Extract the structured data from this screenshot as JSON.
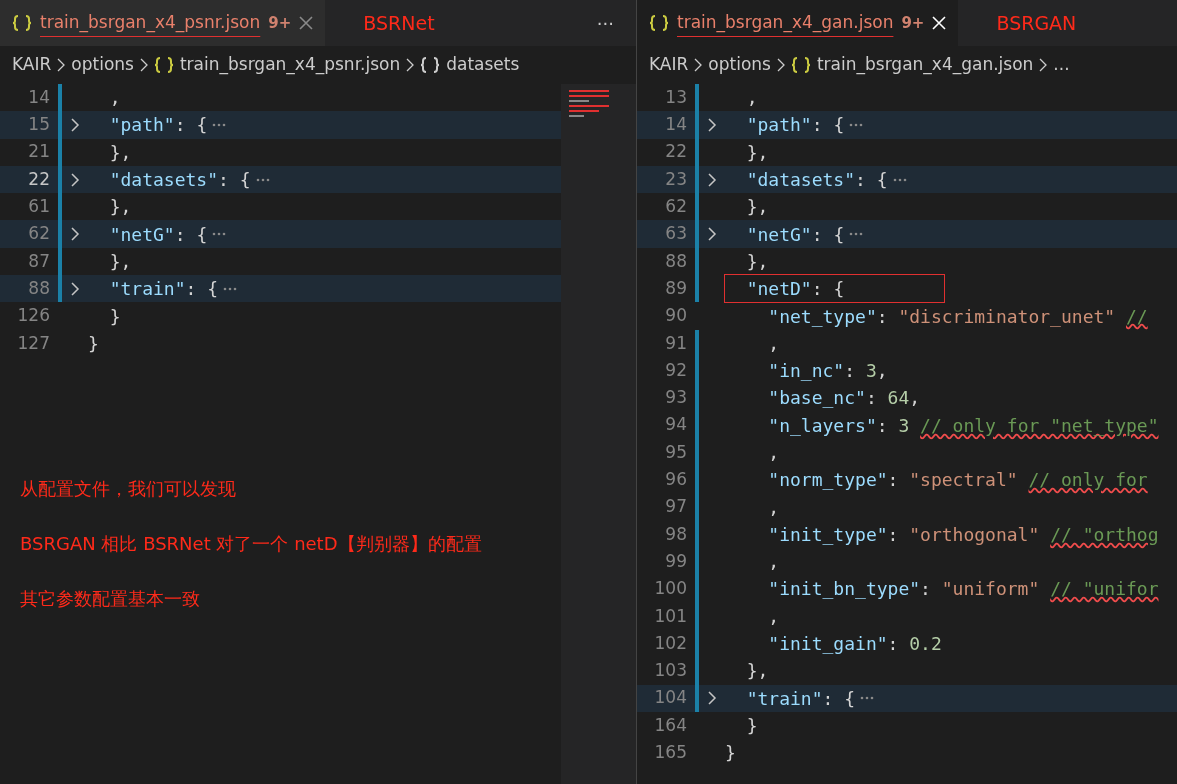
{
  "panes": [
    {
      "tab": {
        "label": "train_bsrgan_x4_psnr.json",
        "badge": "9+",
        "selected": false,
        "underlined": true
      },
      "annotation": "BSRNet",
      "more": "···",
      "breadcrumb": [
        {
          "kind": "text",
          "text": "KAIR"
        },
        {
          "kind": "text",
          "text": "options"
        },
        {
          "kind": "file",
          "text": "train_bsrgan_x4_psnr.json"
        },
        {
          "kind": "symbol",
          "text": "datasets"
        }
      ],
      "lines": [
        {
          "num": "14",
          "folded": false,
          "current": false,
          "changed": true,
          "boxed": false,
          "tokens": [
            {
              "kind": "punct",
              "text": "  ,"
            }
          ]
        },
        {
          "num": "15",
          "folded": true,
          "current": false,
          "changed": true,
          "boxed": false,
          "tokens": [
            {
              "kind": "key",
              "text": "  \"path\""
            },
            {
              "kind": "punct",
              "text": ": {"
            }
          ]
        },
        {
          "num": "21",
          "folded": false,
          "current": false,
          "changed": true,
          "boxed": false,
          "tokens": [
            {
              "kind": "punct",
              "text": "  },"
            }
          ]
        },
        {
          "num": "22",
          "folded": true,
          "current": true,
          "changed": true,
          "boxed": false,
          "tokens": [
            {
              "kind": "key",
              "text": "  \"datasets\""
            },
            {
              "kind": "punct",
              "text": ": {"
            }
          ]
        },
        {
          "num": "61",
          "folded": false,
          "current": false,
          "changed": true,
          "boxed": false,
          "tokens": [
            {
              "kind": "punct",
              "text": "  },"
            }
          ]
        },
        {
          "num": "62",
          "folded": true,
          "current": false,
          "changed": true,
          "boxed": false,
          "tokens": [
            {
              "kind": "key",
              "text": "  \"netG\""
            },
            {
              "kind": "punct",
              "text": ": {"
            }
          ]
        },
        {
          "num": "87",
          "folded": false,
          "current": false,
          "changed": true,
          "boxed": false,
          "tokens": [
            {
              "kind": "punct",
              "text": "  },"
            }
          ]
        },
        {
          "num": "88",
          "folded": true,
          "current": false,
          "changed": true,
          "boxed": false,
          "tokens": [
            {
              "kind": "key",
              "text": "  \"train\""
            },
            {
              "kind": "punct",
              "text": ": {"
            }
          ]
        },
        {
          "num": "126",
          "folded": false,
          "current": false,
          "changed": false,
          "boxed": false,
          "tokens": [
            {
              "kind": "punct",
              "text": "  }"
            }
          ]
        },
        {
          "num": "127",
          "folded": false,
          "current": false,
          "changed": false,
          "boxed": false,
          "tokens": [
            {
              "kind": "punct",
              "text": "}"
            }
          ]
        }
      ],
      "notes": [
        "从配置文件，我们可以发现",
        "BSRGAN 相比 BSRNet 对了一个 netD【判别器】的配置",
        "其它参数配置基本一致"
      ]
    },
    {
      "tab": {
        "label": "train_bsrgan_x4_gan.json",
        "badge": "9+",
        "selected": true,
        "underlined": true
      },
      "annotation": "BSRGAN",
      "breadcrumb": [
        {
          "kind": "text",
          "text": "KAIR"
        },
        {
          "kind": "text",
          "text": "options"
        },
        {
          "kind": "file",
          "text": "train_bsrgan_x4_gan.json"
        },
        {
          "kind": "text",
          "text": "..."
        }
      ],
      "lines": [
        {
          "num": "13",
          "folded": false,
          "current": false,
          "changed": true,
          "boxed": false,
          "tokens": [
            {
              "kind": "punct",
              "text": "  ,"
            }
          ]
        },
        {
          "num": "14",
          "folded": true,
          "current": false,
          "changed": true,
          "boxed": false,
          "tokens": [
            {
              "kind": "key",
              "text": "  \"path\""
            },
            {
              "kind": "punct",
              "text": ": {"
            }
          ]
        },
        {
          "num": "22",
          "folded": false,
          "current": false,
          "changed": true,
          "boxed": false,
          "tokens": [
            {
              "kind": "punct",
              "text": "  },"
            }
          ]
        },
        {
          "num": "23",
          "folded": true,
          "current": false,
          "changed": true,
          "boxed": false,
          "tokens": [
            {
              "kind": "key",
              "text": "  \"datasets\""
            },
            {
              "kind": "punct",
              "text": ": {"
            }
          ]
        },
        {
          "num": "62",
          "folded": false,
          "current": false,
          "changed": true,
          "boxed": false,
          "tokens": [
            {
              "kind": "punct",
              "text": "  },"
            }
          ]
        },
        {
          "num": "63",
          "folded": true,
          "current": false,
          "changed": true,
          "boxed": false,
          "tokens": [
            {
              "kind": "key",
              "text": "  \"netG\""
            },
            {
              "kind": "punct",
              "text": ": {"
            }
          ]
        },
        {
          "num": "88",
          "folded": false,
          "current": false,
          "changed": true,
          "boxed": false,
          "tokens": [
            {
              "kind": "punct",
              "text": "  },"
            }
          ]
        },
        {
          "num": "89",
          "folded": false,
          "current": false,
          "changed": true,
          "boxed": true,
          "tokens": [
            {
              "kind": "key",
              "text": "  \"netD\""
            },
            {
              "kind": "punct",
              "text": ": {"
            }
          ]
        },
        {
          "num": "90",
          "folded": false,
          "current": false,
          "changed": false,
          "boxed": false,
          "tokens": [
            {
              "kind": "key",
              "text": "    \"net_type\""
            },
            {
              "kind": "punct",
              "text": ": "
            },
            {
              "kind": "str",
              "text": "\"discriminator_unet\" "
            },
            {
              "kind": "comment",
              "text": "//"
            }
          ]
        },
        {
          "num": "91",
          "folded": false,
          "current": false,
          "changed": true,
          "boxed": false,
          "tokens": [
            {
              "kind": "punct",
              "text": "    ,"
            }
          ]
        },
        {
          "num": "92",
          "folded": false,
          "current": false,
          "changed": true,
          "boxed": false,
          "tokens": [
            {
              "kind": "key",
              "text": "    \"in_nc\""
            },
            {
              "kind": "punct",
              "text": ": "
            },
            {
              "kind": "num",
              "text": "3"
            },
            {
              "kind": "punct",
              "text": ","
            }
          ]
        },
        {
          "num": "93",
          "folded": false,
          "current": false,
          "changed": true,
          "boxed": false,
          "tokens": [
            {
              "kind": "key",
              "text": "    \"base_nc\""
            },
            {
              "kind": "punct",
              "text": ": "
            },
            {
              "kind": "num",
              "text": "64"
            },
            {
              "kind": "punct",
              "text": ","
            }
          ]
        },
        {
          "num": "94",
          "folded": false,
          "current": false,
          "changed": true,
          "boxed": false,
          "tokens": [
            {
              "kind": "key",
              "text": "    \"n_layers\""
            },
            {
              "kind": "punct",
              "text": ": "
            },
            {
              "kind": "num",
              "text": "3 "
            },
            {
              "kind": "comment",
              "text": "// only for \"net_type\""
            }
          ]
        },
        {
          "num": "95",
          "folded": false,
          "current": false,
          "changed": true,
          "boxed": false,
          "tokens": [
            {
              "kind": "punct",
              "text": "    ,"
            }
          ]
        },
        {
          "num": "96",
          "folded": false,
          "current": false,
          "changed": true,
          "boxed": false,
          "tokens": [
            {
              "kind": "key",
              "text": "    \"norm_type\""
            },
            {
              "kind": "punct",
              "text": ": "
            },
            {
              "kind": "str",
              "text": "\"spectral\" "
            },
            {
              "kind": "comment",
              "text": "// only for"
            }
          ]
        },
        {
          "num": "97",
          "folded": false,
          "current": false,
          "changed": true,
          "boxed": false,
          "tokens": [
            {
              "kind": "punct",
              "text": "    ,"
            }
          ]
        },
        {
          "num": "98",
          "folded": false,
          "current": false,
          "changed": true,
          "boxed": false,
          "tokens": [
            {
              "kind": "key",
              "text": "    \"init_type\""
            },
            {
              "kind": "punct",
              "text": ": "
            },
            {
              "kind": "str",
              "text": "\"orthogonal\" "
            },
            {
              "kind": "comment",
              "text": "// \"orthog"
            }
          ]
        },
        {
          "num": "99",
          "folded": false,
          "current": false,
          "changed": true,
          "boxed": false,
          "tokens": [
            {
              "kind": "punct",
              "text": "    ,"
            }
          ]
        },
        {
          "num": "100",
          "folded": false,
          "current": false,
          "changed": true,
          "boxed": false,
          "tokens": [
            {
              "kind": "key",
              "text": "    \"init_bn_type\""
            },
            {
              "kind": "punct",
              "text": ": "
            },
            {
              "kind": "str",
              "text": "\"uniform\" "
            },
            {
              "kind": "comment",
              "text": "// \"unifor"
            }
          ]
        },
        {
          "num": "101",
          "folded": false,
          "current": false,
          "changed": true,
          "boxed": false,
          "tokens": [
            {
              "kind": "punct",
              "text": "    ,"
            }
          ]
        },
        {
          "num": "102",
          "folded": false,
          "current": false,
          "changed": true,
          "boxed": false,
          "tokens": [
            {
              "kind": "key",
              "text": "    \"init_gain\""
            },
            {
              "kind": "punct",
              "text": ": "
            },
            {
              "kind": "num",
              "text": "0.2"
            }
          ]
        },
        {
          "num": "103",
          "folded": false,
          "current": false,
          "changed": true,
          "boxed": false,
          "tokens": [
            {
              "kind": "punct",
              "text": "  },"
            }
          ]
        },
        {
          "num": "104",
          "folded": true,
          "current": false,
          "changed": true,
          "boxed": false,
          "tokens": [
            {
              "kind": "key",
              "text": "  \"train\""
            },
            {
              "kind": "punct",
              "text": ": {"
            }
          ]
        },
        {
          "num": "164",
          "folded": false,
          "current": false,
          "changed": false,
          "boxed": false,
          "tokens": [
            {
              "kind": "punct",
              "text": "  }"
            }
          ]
        },
        {
          "num": "165",
          "folded": false,
          "current": false,
          "changed": false,
          "boxed": false,
          "tokens": [
            {
              "kind": "punct",
              "text": "}"
            }
          ]
        }
      ]
    }
  ]
}
